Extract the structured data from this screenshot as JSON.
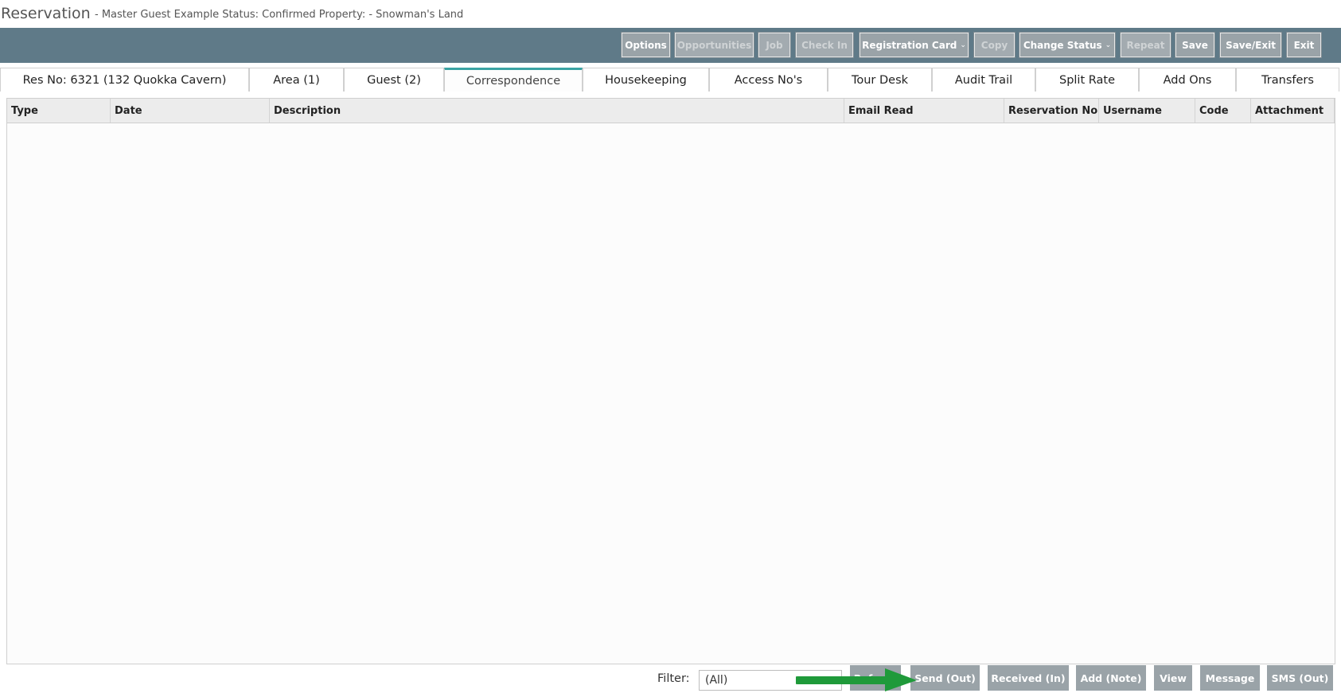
{
  "titlebar": {
    "title": "Reservation",
    "subtitle": "- Master Guest Example    Status: Confirmed Property: - Snowman's Land"
  },
  "toolbar": {
    "buttons": [
      {
        "label": "Options",
        "enabled": true
      },
      {
        "label": "Opportunities",
        "enabled": false
      },
      {
        "label": "Job",
        "enabled": false
      },
      {
        "label": "Check In",
        "enabled": false
      },
      {
        "label": "Registration Card",
        "enabled": true,
        "dropdown": true
      },
      {
        "label": "Copy",
        "enabled": false
      },
      {
        "label": "Change Status",
        "enabled": true,
        "dropdown": true
      },
      {
        "label": "Repeat",
        "enabled": false
      },
      {
        "label": "Save",
        "enabled": true
      },
      {
        "label": "Save/Exit",
        "enabled": true
      },
      {
        "label": "Exit",
        "enabled": true
      }
    ]
  },
  "tabs": [
    {
      "label": "Res No: 6321 (132 Quokka Cavern)"
    },
    {
      "label": "Area (1)"
    },
    {
      "label": "Guest (2)"
    },
    {
      "label": "Correspondence",
      "active": true
    },
    {
      "label": "Housekeeping"
    },
    {
      "label": "Access No's"
    },
    {
      "label": "Tour Desk"
    },
    {
      "label": "Audit Trail"
    },
    {
      "label": "Split Rate"
    },
    {
      "label": "Add Ons"
    },
    {
      "label": "Transfers"
    }
  ],
  "grid": {
    "columns": [
      "Type",
      "Date",
      "Description",
      "Email Read",
      "Reservation No",
      "Username",
      "Code",
      "Attachment"
    ],
    "rows": []
  },
  "footer": {
    "filter_label": "Filter:",
    "filter_value": "(All)",
    "buttons": [
      "Send (Out)",
      "Received (In)",
      "Add (Note)",
      "View",
      "Message",
      "SMS (Out)"
    ],
    "refresh_label": "Refresh"
  },
  "annotation": {
    "arrow_color": "#1f9a3a",
    "points_to": "Send (Out)"
  },
  "colors": {
    "toolbar_bg": "#5f7a88",
    "button_bg": "#9aa3a8",
    "active_tab_accent": "#3aa3a3"
  }
}
